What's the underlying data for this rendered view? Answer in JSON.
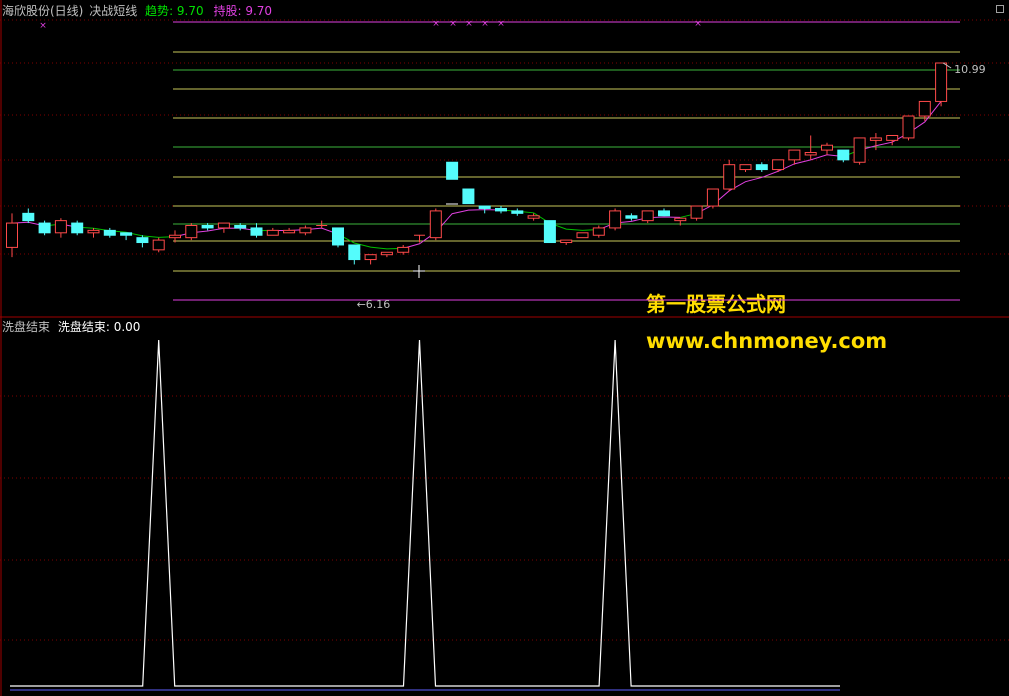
{
  "main_panel": {
    "stock_name": "海欣股份(日线)",
    "indicator_name": "决战短线",
    "trend_label": "趋势",
    "trend_value": "9.70",
    "hold_label": "持股",
    "hold_value": "9.70",
    "max_price_label": "10.99",
    "min_price_label": "6.16",
    "colors": {
      "up": "#ff4a4a",
      "down": "#54fcfc",
      "trend_line": "#00c000",
      "hold_line": "#e040e0",
      "h_line": "#c8c85a",
      "g_line": "#3cb43c"
    }
  },
  "sub_panel": {
    "indicator_name": "洗盘结束",
    "value_label": "洗盘结束",
    "value": "0.00"
  },
  "watermark": {
    "title": "第一股票公式网",
    "url": "www.chnmoney.com"
  },
  "chart_data": [
    {
      "type": "candlestick",
      "title": "海欣股份(日线) 决战短线",
      "annotations": [
        "10.99",
        "6.16"
      ],
      "ohlc": [
        [
          7.2,
          7.9,
          7.0,
          7.7
        ],
        [
          7.9,
          8.0,
          7.7,
          7.75
        ],
        [
          7.7,
          7.75,
          7.45,
          7.5
        ],
        [
          7.5,
          7.8,
          7.4,
          7.75
        ],
        [
          7.7,
          7.75,
          7.45,
          7.5
        ],
        [
          7.5,
          7.6,
          7.4,
          7.55
        ],
        [
          7.55,
          7.6,
          7.4,
          7.45
        ],
        [
          7.5,
          7.5,
          7.35,
          7.45
        ],
        [
          7.4,
          7.45,
          7.2,
          7.3
        ],
        [
          7.15,
          7.4,
          7.1,
          7.35
        ],
        [
          7.4,
          7.55,
          7.3,
          7.45
        ],
        [
          7.4,
          7.7,
          7.35,
          7.65
        ],
        [
          7.65,
          7.7,
          7.55,
          7.6
        ],
        [
          7.6,
          7.7,
          7.5,
          7.7
        ],
        [
          7.65,
          7.7,
          7.55,
          7.6
        ],
        [
          7.6,
          7.7,
          7.4,
          7.45
        ],
        [
          7.45,
          7.6,
          7.45,
          7.55
        ],
        [
          7.5,
          7.6,
          7.5,
          7.55
        ],
        [
          7.5,
          7.65,
          7.45,
          7.6
        ],
        [
          7.65,
          7.75,
          7.6,
          7.65
        ],
        [
          7.6,
          7.6,
          7.2,
          7.25
        ],
        [
          7.25,
          7.25,
          6.85,
          6.95
        ],
        [
          6.95,
          7.05,
          6.85,
          7.05
        ],
        [
          7.05,
          7.1,
          7.0,
          7.1
        ],
        [
          7.1,
          7.25,
          7.05,
          7.2
        ],
        [
          7.45,
          7.45,
          7.3,
          7.45
        ],
        [
          7.4,
          8.0,
          7.35,
          7.95
        ],
        [
          8.95,
          8.95,
          8.6,
          8.6
        ],
        [
          8.4,
          8.4,
          8.1,
          8.1
        ],
        [
          8.05,
          8.05,
          7.9,
          8.0
        ],
        [
          8.0,
          8.05,
          7.9,
          7.95
        ],
        [
          7.95,
          8.0,
          7.85,
          7.9
        ],
        [
          7.8,
          7.9,
          7.75,
          7.85
        ],
        [
          7.75,
          7.75,
          7.3,
          7.3
        ],
        [
          7.3,
          7.35,
          7.25,
          7.35
        ],
        [
          7.4,
          7.5,
          7.4,
          7.5
        ],
        [
          7.45,
          7.65,
          7.4,
          7.6
        ],
        [
          7.6,
          8.0,
          7.55,
          7.95
        ],
        [
          7.85,
          7.9,
          7.75,
          7.8
        ],
        [
          7.75,
          7.95,
          7.7,
          7.95
        ],
        [
          7.95,
          8.0,
          7.85,
          7.85
        ],
        [
          7.75,
          7.8,
          7.65,
          7.8
        ],
        [
          7.8,
          8.05,
          7.75,
          8.05
        ],
        [
          8.05,
          8.4,
          8.0,
          8.4
        ],
        [
          8.4,
          9.0,
          8.35,
          8.9
        ],
        [
          8.8,
          8.9,
          8.75,
          8.9
        ],
        [
          8.9,
          8.95,
          8.75,
          8.8
        ],
        [
          8.8,
          9.0,
          8.75,
          9.0
        ],
        [
          9.0,
          9.2,
          8.9,
          9.2
        ],
        [
          9.1,
          9.5,
          9.0,
          9.15
        ],
        [
          9.2,
          9.35,
          9.1,
          9.3
        ],
        [
          9.2,
          9.2,
          8.95,
          9.0
        ],
        [
          8.95,
          9.45,
          8.9,
          9.45
        ],
        [
          9.4,
          9.55,
          9.2,
          9.45
        ],
        [
          9.4,
          9.5,
          9.3,
          9.5
        ],
        [
          9.45,
          9.9,
          9.4,
          9.9
        ],
        [
          9.9,
          10.2,
          9.8,
          10.2
        ],
        [
          10.2,
          10.95,
          10.1,
          10.99
        ]
      ]
    },
    {
      "type": "line",
      "title": "洗盘结束",
      "values": [
        0,
        0,
        0,
        0,
        0,
        0,
        0,
        0,
        0,
        1,
        0,
        0,
        0,
        0,
        0,
        0,
        0,
        0,
        0,
        0,
        0,
        0,
        0,
        0,
        0,
        1,
        0,
        0,
        0,
        0,
        0,
        0,
        0,
        0,
        0,
        0,
        0,
        1,
        0,
        0,
        0,
        0,
        0,
        0,
        0,
        0,
        0,
        0,
        0,
        0,
        0,
        0,
        0,
        0,
        0,
        0,
        0,
        0
      ],
      "current_value": "0.00"
    }
  ]
}
